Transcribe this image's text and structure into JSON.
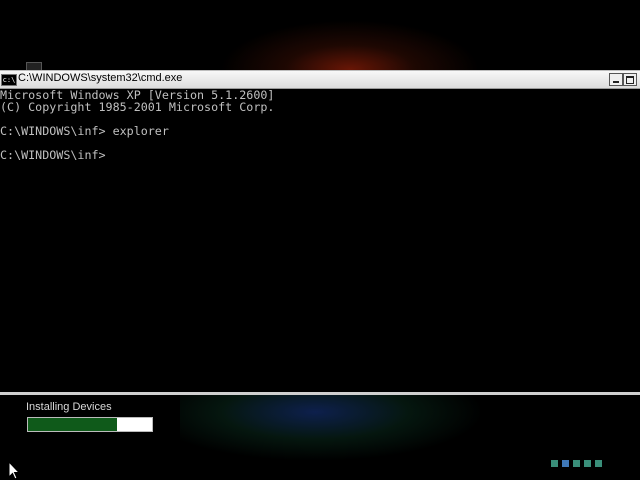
{
  "window": {
    "title": "C:\\WINDOWS\\system32\\cmd.exe",
    "icon_text": "c:\\"
  },
  "console": {
    "lines": [
      "Microsoft Windows XP [Version 5.1.2600]",
      "(C) Copyright 1985-2001 Microsoft Corp.",
      "",
      "C:\\WINDOWS\\inf> explorer",
      "",
      "C:\\WINDOWS\\inf>"
    ]
  },
  "install": {
    "label": "Installing Devices",
    "progress": 0.72
  },
  "colors": {
    "progress_fill": "#0f5a1a",
    "dot_green": "#3a8f7a",
    "dot_blue": "#3f78b8"
  },
  "icons": {
    "window_icon": "cmd-icon",
    "minimize": "minimize-icon",
    "maximize": "maximize-icon",
    "pointer": "mouse-pointer-icon"
  }
}
